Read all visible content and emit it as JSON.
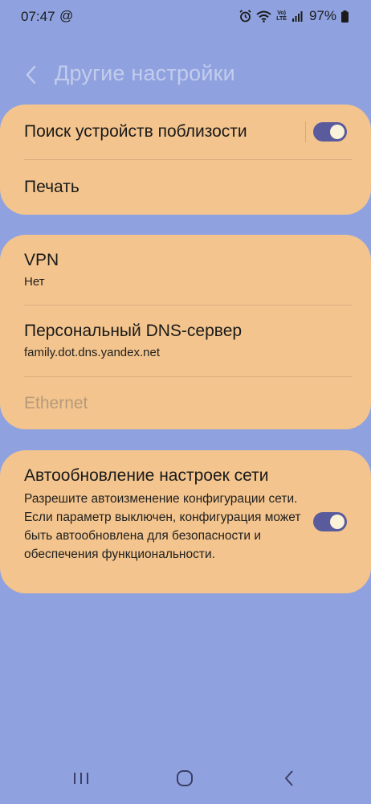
{
  "status_bar": {
    "time": "07:47",
    "at_symbol": "@",
    "volte_line1": "Vo)",
    "volte_line2": "LTE",
    "battery": "97%"
  },
  "header": {
    "title": "Другие настройки"
  },
  "card1": {
    "nearby_title": "Поиск устройств поблизости",
    "nearby_enabled": true,
    "print_title": "Печать"
  },
  "card2": {
    "vpn_title": "VPN",
    "vpn_value": "Нет",
    "dns_title": "Персональный DNS-сервер",
    "dns_value": "family.dot.dns.yandex.net",
    "ethernet_title": "Ethernet"
  },
  "card3": {
    "auto_title": "Автообновление настроек сети",
    "auto_desc": "Разрешите автоизменение конфигурации сети. Если параметр выключен, конфигурация может быть автообновлена для безопасности и обеспечения функциональности.",
    "auto_enabled": true
  },
  "colors": {
    "background": "#8fa2df",
    "card": "#f3c48d",
    "toggle_on": "#5a5b9c",
    "title_color": "#c3ccec"
  },
  "icons": {
    "back": "chevron-left-icon",
    "alarm": "alarm-icon",
    "wifi": "wifi-icon",
    "signal": "signal-icon",
    "battery": "battery-icon",
    "nav_recents": "recents-icon",
    "nav_home": "home-icon",
    "nav_back": "back-icon"
  }
}
